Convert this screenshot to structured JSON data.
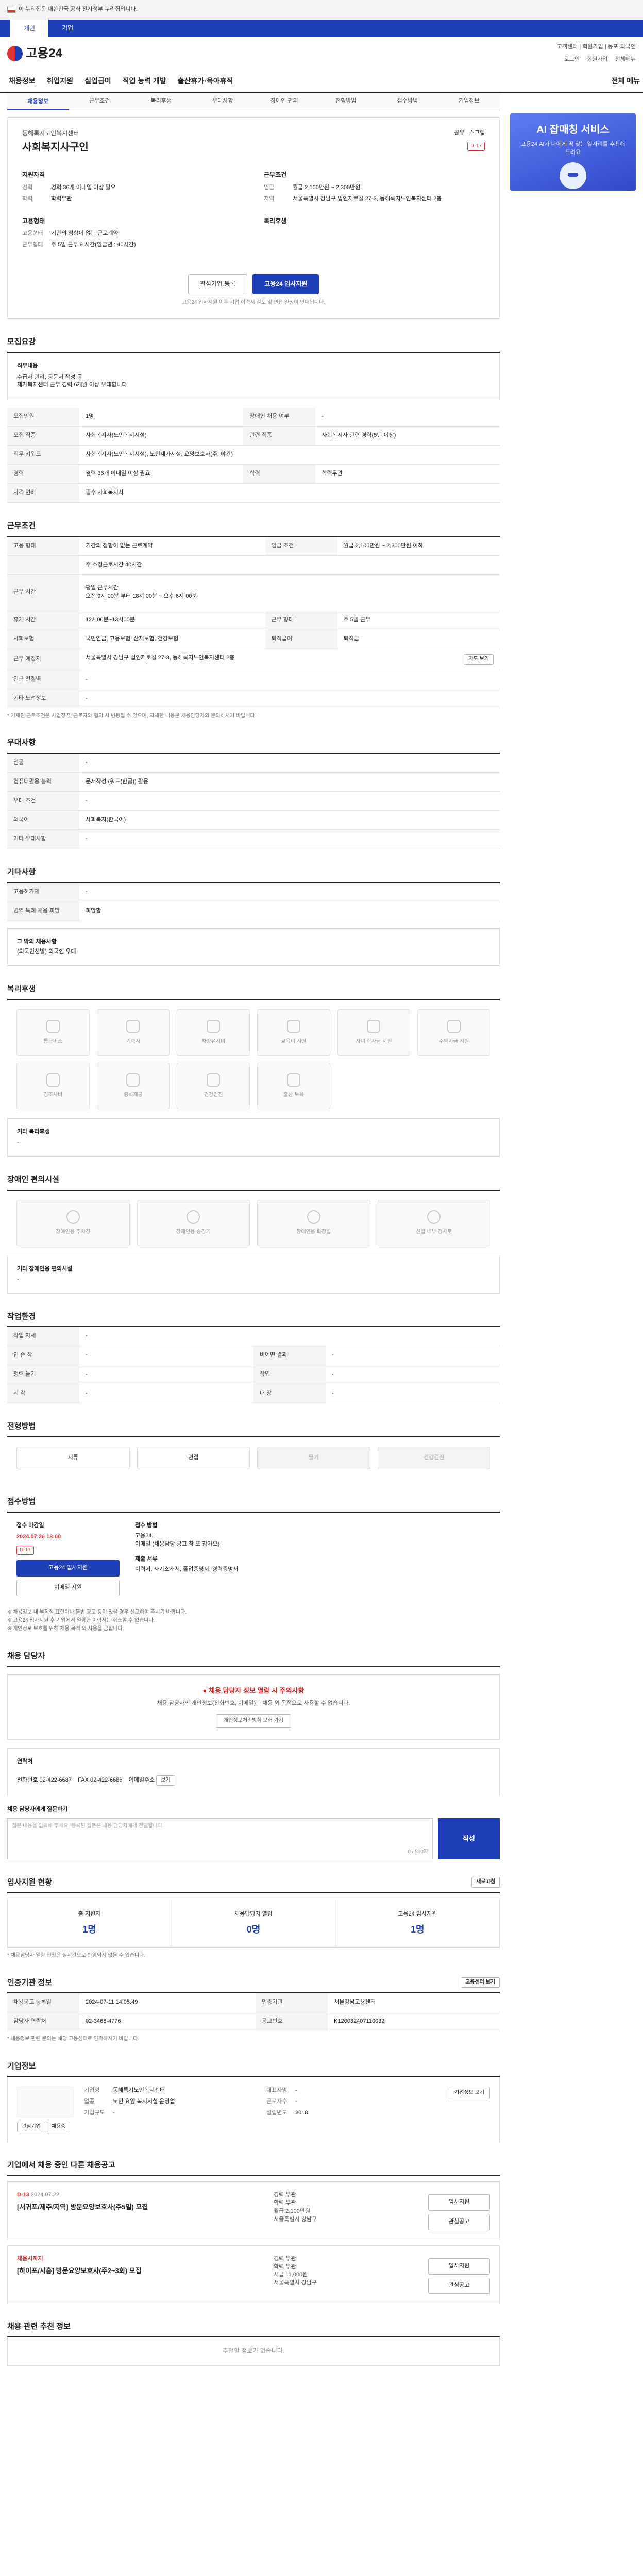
{
  "gov_banner": "이 누리집은 대한민국 공식 전자정부 누리집입니다.",
  "top_tabs": [
    "개인",
    "기업"
  ],
  "logo_text": "고용24",
  "header_right": {
    "row1": "고객센터 | 회원가입 | 동포·외국인",
    "row2": [
      "로그인",
      "회원가입",
      "전체메뉴"
    ]
  },
  "gnb": [
    "채용정보",
    "취업지원",
    "실업급여",
    "직업 능력 개발",
    "출산휴가·육아휴직"
  ],
  "all_menu": "전체 메뉴",
  "subtabs": [
    "채용정보",
    "근무조건",
    "복리후생",
    "우대사항",
    "장애인 편의",
    "전형방법",
    "접수방법",
    "기업정보"
  ],
  "job": {
    "company": "동해록지노인복지센터",
    "title": "사회복지사구인",
    "share": "공유",
    "scrap": "스크랩",
    "dday": "D-17",
    "apply_title": "지원자격",
    "apply_rows": [
      {
        "k": "경력",
        "v": "경력 36개 이내일 이상 필요"
      },
      {
        "k": "학력",
        "v": "학력무관"
      }
    ],
    "cond_title": "근무조건",
    "cond_rows": [
      {
        "k": "임금",
        "v": "월급 2,100만원 ~ 2,300만원"
      },
      {
        "k": "지역",
        "v": "서울특별시 강남구 법인지로길 27-3, 동해록지노인복지센터 2층"
      }
    ],
    "type_title": "고용형태",
    "type_rows": [
      {
        "k": "고용형태",
        "v": "기간의 정함이 없는 근로계약"
      },
      {
        "k": "근무형태",
        "v": "주 5일 근무 9 시간(임금년 : 40시간)"
      }
    ],
    "benefit_title": "복리후생",
    "btn_interest": "관심기업 등록",
    "btn_apply": "고용24 입사지원",
    "note": "고용24 입사지원 이후 기업 이력서 검토 및 면접 일정이 안내됩니다."
  },
  "recruit": {
    "title": "모집요강",
    "duty_label": "직무내용",
    "duty_text": "수급자 관리, 공문서 작성 등\n재가복지센터 근무 경력 6개월 이상 우대합니다",
    "rows": [
      {
        "k": "모집인원",
        "v": "1명",
        "k2": "장애인 채용 여부",
        "v2": "-"
      },
      {
        "k": "모집 직종",
        "v": "사회복지사(노인복지시설)",
        "k2": "관련 직종",
        "v2": "사회복지사 관련 경력(5년 이상)"
      },
      {
        "k": "직무 키워드",
        "v": "사회복지사(노인복지시설), 노인재가시설, 요양보호사(주, 야간)",
        "k2": "",
        "v2": ""
      },
      {
        "k": "경력",
        "v": "경력 36개 이내일 이상 필요",
        "k2": "학력",
        "v2": "학력무관"
      },
      {
        "k": "자격 면허",
        "v": "필수  사회복지사",
        "k2": "",
        "v2": ""
      }
    ]
  },
  "work": {
    "title": "근무조건",
    "rows": [
      {
        "k": "고용 형태",
        "v": "기간의 정함이 없는 근로계약",
        "k2": "임금 조건",
        "v2": "월급 2,100만원 ~ 2,300만원 이하"
      },
      {
        "k": "",
        "v": "주 소정근로시간  40시간",
        "k2": "",
        "v2": ""
      },
      {
        "k": "근무 시간",
        "v": "평일 근무시간\n오전 9시 00분 부터 18시 00분 ~ 오후 6시 00분",
        "k2": "",
        "v2": ""
      },
      {
        "k": "휴게 시간",
        "v": "12시00분~13시00분",
        "k2": "근무 형태",
        "v2": "주 5일 근무"
      },
      {
        "k": "사회보험",
        "v": "국민연금, 고용보험, 산재보험, 건강보험",
        "k2": "퇴직급여",
        "v2": "퇴직금"
      },
      {
        "k": "근무 예정지",
        "v": "서울특별시 강남구 법인지로길 27-3, 동해록지노인복지센터 2층",
        "k2": "",
        "v2": ""
      },
      {
        "k": "인근 전철역",
        "v": "-",
        "k2": "",
        "v2": ""
      },
      {
        "k": "기타 노선정보",
        "v": "-",
        "k2": "",
        "v2": ""
      }
    ],
    "map_btn": "지도 보기",
    "note": "* 기재된 근로조건은 사업장 및 근로자와 협의 시 변동될 수 있으며, 자세한 내용은 채용담당자와 문의하시기 바랍니다."
  },
  "pref": {
    "title": "우대사항",
    "rows": [
      {
        "k": "전공",
        "v": "-"
      },
      {
        "k": "컴퓨터활용 능력",
        "v": "문서작성 (워드(한글)) 활용"
      },
      {
        "k": "우대 조건",
        "v": "-"
      },
      {
        "k": "외국어",
        "v": "사회복지(한국어)"
      },
      {
        "k": "기타 우대사항",
        "v": "-"
      }
    ]
  },
  "etc": {
    "title": "기타사항",
    "rows": [
      {
        "k": "고용허가제",
        "v": "-"
      },
      {
        "k": "병역 특례 채용 희망",
        "v": "희망함"
      }
    ],
    "extra_title": "그 밖의 채용사항",
    "extra_text": "(외국민선발) 외국인 우대"
  },
  "benefits": {
    "title": "복리후생",
    "items": [
      "통근버스",
      "기숙사",
      "차량유지비",
      "교육비 지원",
      "자녀 학자금 지원",
      "주택자금 지원",
      "경조사비",
      "중식제공",
      "건강검진",
      "출산·보육"
    ],
    "other_label": "기타 복리후생",
    "other_text": "-"
  },
  "facility": {
    "title": "장애인 편의시설",
    "items": [
      "장애인용 주차장",
      "장애인용 승강기",
      "장애인용 화장실",
      "신발 내부 경사로"
    ],
    "other_label": "기타 장애인용 편의시설",
    "other_text": "-"
  },
  "env": {
    "title": "작업환경",
    "rows": [
      {
        "k": "작업 자세",
        "v": "-",
        "k2": "",
        "v2": ""
      },
      {
        "k": "인 손 작",
        "v": "-",
        "k2": "비어떤 결과",
        "v2": "-"
      },
      {
        "k": "청력 들기",
        "v": "-",
        "k2": "작업",
        "v2": "-"
      },
      {
        "k": "시 각",
        "v": "-",
        "k2": "대 장",
        "v2": "-"
      }
    ]
  },
  "process": {
    "title": "전형방법",
    "steps": [
      "서류",
      "면접",
      "필기",
      "건강검진"
    ]
  },
  "apply": {
    "title": "접수방법",
    "deadline_label": "접수 마감일",
    "deadline": "2024.07.26 18:00",
    "dday": "D-17",
    "apply_btn": "고용24 입사지원",
    "email_btn": "이메일 지원",
    "method_label": "접수 방법",
    "method_text": "고용24,\n이메일 (채용담당 공고 참 또 참가요)",
    "docs_label": "제출 서류",
    "docs_text": "이력서, 자기소개서, 졸업증명서, 경력증명서",
    "bullets": [
      "※ 채용정보 내 부적절 표현이나 불법 광고 등이 있을 경우 신고하여 주시기 바랍니다.",
      "※ 고용24 입사지원 후 기업에서 열람한 이력서는 취소할 수 없습니다.",
      "※ 개인정보 보호를 위해 채용 목적 외 사용을 금합니다."
    ]
  },
  "contact": {
    "title": "채용 담당자",
    "warn_title": "채용 담당자 정보 열람 시 주의사항",
    "warn_text": "채용 담당자의 개인정보(전화번호, 이메일)는 채용 외 목적으로 사용할 수 없습니다.",
    "warn_btn": "개인정보처리방침 보러 가기",
    "box_title": "연락처",
    "phone_label": "전화번호",
    "phone": "02-422-6687",
    "fax_label": "FAX",
    "fax": "02-422-6686",
    "email_label": "이메일주소",
    "email_btn": "보기",
    "q_title": "채용 담당자에게 질문하기",
    "q_placeholder": "질문 내용을 입력해 주세요. 등록된 질문은 채용 담당자에게 전달됩니다.",
    "q_count": "0 / 500자",
    "q_btn": "작성"
  },
  "status": {
    "title": "입사지원 현황",
    "refresh": "새로고침",
    "items": [
      {
        "l": "총 지원자",
        "n": "1명"
      },
      {
        "l": "채용담당자 열람",
        "n": "0명"
      },
      {
        "l": "고용24 입사지원",
        "n": "1명"
      }
    ],
    "note": "* 채용담당자 열람 현황은 실시간으로 반영되지 않을 수 있습니다."
  },
  "institution": {
    "title": "인증기관 정보",
    "btn": "고용센터 보기",
    "rows": [
      {
        "k": "채용공고 등록일",
        "v": "2024-07-11 14:05:49",
        "k2": "인증기관",
        "v2": "서울강남고용센터"
      },
      {
        "k": "담당자 연락처",
        "v": "02-3468-4776",
        "k2": "공고번호",
        "v2": "K120032407110032"
      }
    ],
    "note": "* 채용정보 관련 문의는 해당 고용센터로 연락하시기 바랍니다."
  },
  "org": {
    "title": "기업정보",
    "btn1": "관심기업",
    "btn2": "채용중",
    "rows": [
      {
        "k": "기업명",
        "v": "동해록지노인복지센터"
      },
      {
        "k": "업종",
        "v": "노인 요양 복지시설 운영업"
      },
      {
        "k": "기업규모",
        "v": "-"
      }
    ],
    "rows2": [
      {
        "k": "대표자명",
        "v": "-"
      },
      {
        "k": "근로자수",
        "v": "-"
      },
      {
        "k": "설립년도",
        "v": "2018"
      }
    ],
    "view_btn": "기업정보 보기"
  },
  "others": {
    "title": "기업에서 채용 중인 다른 채용공고",
    "jobs": [
      {
        "tag": "D-13",
        "date": "2024.07.22",
        "title": "[서귀포/제주/지역] 방문요양보호사(주5일) 모집",
        "m": [
          "경력 무관",
          "학력 무관",
          "월급 2,100만원",
          "서울특별시 강남구"
        ],
        "b1": "입사지원",
        "b2": "관심공고"
      },
      {
        "tag": "채용시까지",
        "date": "",
        "title": "[하이포/시흥] 방문요양보호사(주2~3회) 모집",
        "m": [
          "경력 무관",
          "학력 무관",
          "시급 11,000원",
          "서울특별시 강남구"
        ],
        "b1": "입사지원",
        "b2": "관심공고"
      }
    ]
  },
  "recommend": {
    "title": "채용 관련 추천 정보",
    "empty": "추천할 정보가 없습니다."
  },
  "side_banner": {
    "title": "AI 잡매칭 서비스",
    "desc": "고용24 AI가 나에게 딱 맞는 일자리를 추천해 드려요"
  }
}
